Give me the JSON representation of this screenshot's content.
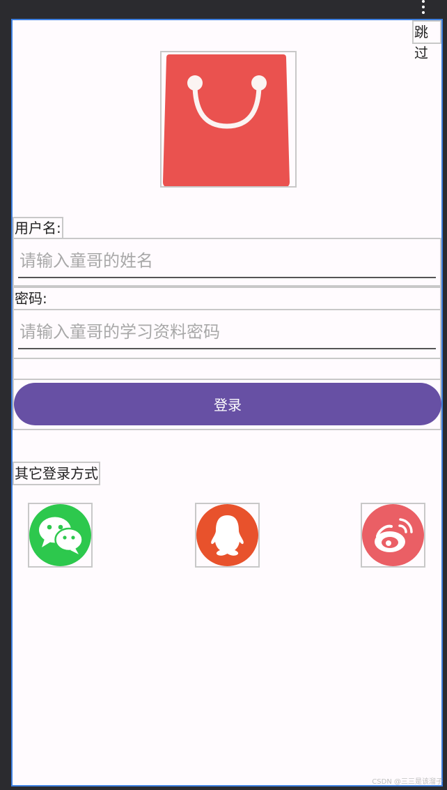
{
  "app": {
    "skip_label": "跳过",
    "logo_icon": "shopping-bag-icon",
    "username_label": "用户名:",
    "username_placeholder": "请输入童哥的姓名",
    "username_value": "",
    "password_label": "密码:",
    "password_placeholder": "请输入童哥的学习资料密码",
    "password_value": "",
    "login_label": "登录",
    "other_login_label": "其它登录方式",
    "social": [
      {
        "name": "wechat",
        "icon": "wechat-icon",
        "color": "#2dc84d"
      },
      {
        "name": "qq",
        "icon": "qq-icon",
        "color": "#e8522c"
      },
      {
        "name": "weibo",
        "icon": "weibo-icon",
        "color": "#ea5f65"
      }
    ]
  },
  "colors": {
    "primary": "#6750a4",
    "bag": "#ea524f",
    "background": "#fffbfe",
    "frame": "#3d7fe0"
  },
  "watermark": "CSDN @三三是该溜子"
}
